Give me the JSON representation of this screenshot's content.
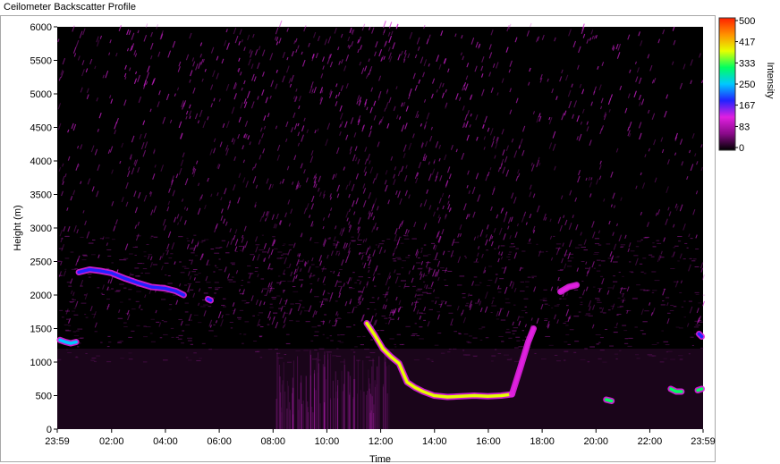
{
  "window": {
    "title": "Ceilometer Backscatter Profile"
  },
  "colors": {
    "plot_background": "#000000",
    "noise": "#d020d0",
    "colorbar": [
      "#000000",
      "#8a0a8a",
      "#e020e0",
      "#2222ff",
      "#00c8ff",
      "#00ff60",
      "#e6ff00",
      "#ff9000",
      "#ff2000"
    ]
  },
  "chart_data": {
    "type": "heatmap",
    "title": "Ceilometer Backscatter Profile",
    "xlabel": "Time",
    "ylabel": "Height (m)",
    "x_ticks": [
      "23:59",
      "02:00",
      "04:00",
      "06:00",
      "08:00",
      "10:00",
      "12:00",
      "14:00",
      "16:00",
      "18:00",
      "20:00",
      "22:00",
      "23:59"
    ],
    "x_tick_hours": [
      0,
      2.02,
      4.02,
      6.02,
      8.02,
      10.02,
      12.02,
      14.02,
      16.02,
      18.02,
      20.02,
      22.02,
      24
    ],
    "xlim_hours": [
      0,
      24
    ],
    "y_ticks": [
      "6000",
      "5500",
      "5000",
      "4500",
      "4000",
      "3500",
      "3000",
      "2500",
      "2000",
      "1500",
      "1000",
      "500",
      "0"
    ],
    "ylim": [
      0,
      6000
    ],
    "colorbar": {
      "label": "Intensity",
      "ticks": [
        "500",
        "417",
        "333",
        "250",
        "167",
        "83",
        "0"
      ],
      "range": [
        0,
        500
      ]
    },
    "cloud_base_layers": [
      {
        "name": "",
        "points": [
          [
            0.1,
            1330
          ],
          [
            0.3,
            1300
          ],
          [
            0.5,
            1280
          ],
          [
            0.7,
            1300
          ]
        ],
        "intensity": 260
      },
      {
        "name": "",
        "points": [
          [
            0.8,
            2340
          ],
          [
            1.2,
            2380
          ],
          [
            1.6,
            2360
          ],
          [
            2.0,
            2330
          ],
          [
            2.5,
            2250
          ],
          [
            3.0,
            2180
          ],
          [
            3.5,
            2120
          ],
          [
            4.0,
            2100
          ],
          [
            4.4,
            2060
          ],
          [
            4.7,
            2000
          ]
        ],
        "intensity": 180
      },
      {
        "name": "",
        "points": [
          [
            5.6,
            1940
          ],
          [
            5.7,
            1920
          ]
        ],
        "intensity": 160
      },
      {
        "name": "",
        "points": [
          [
            11.5,
            1580
          ],
          [
            11.8,
            1400
          ],
          [
            12.1,
            1200
          ],
          [
            12.4,
            1080
          ],
          [
            12.7,
            980
          ],
          [
            13.0,
            700
          ],
          [
            13.3,
            620
          ],
          [
            13.6,
            560
          ],
          [
            14.0,
            500
          ],
          [
            14.5,
            480
          ],
          [
            15.0,
            490
          ],
          [
            15.5,
            500
          ],
          [
            16.0,
            490
          ],
          [
            16.5,
            500
          ],
          [
            16.9,
            520
          ]
        ],
        "intensity": 380
      },
      {
        "name": "",
        "points": [
          [
            16.9,
            520
          ],
          [
            17.2,
            900
          ],
          [
            17.5,
            1300
          ],
          [
            17.7,
            1500
          ]
        ],
        "intensity": 130
      },
      {
        "name": "",
        "points": [
          [
            18.7,
            2050
          ],
          [
            19.0,
            2120
          ],
          [
            19.3,
            2150
          ]
        ],
        "intensity": 140
      },
      {
        "name": "",
        "points": [
          [
            20.4,
            440
          ],
          [
            20.6,
            420
          ]
        ],
        "intensity": 300
      },
      {
        "name": "",
        "points": [
          [
            22.8,
            600
          ],
          [
            23.0,
            560
          ],
          [
            23.2,
            560
          ]
        ],
        "intensity": 300
      },
      {
        "name": "",
        "points": [
          [
            23.8,
            580
          ],
          [
            23.95,
            600
          ]
        ],
        "intensity": 300
      },
      {
        "name": "",
        "points": [
          [
            23.85,
            1420
          ],
          [
            23.95,
            1380
          ]
        ],
        "intensity": 200
      }
    ]
  }
}
